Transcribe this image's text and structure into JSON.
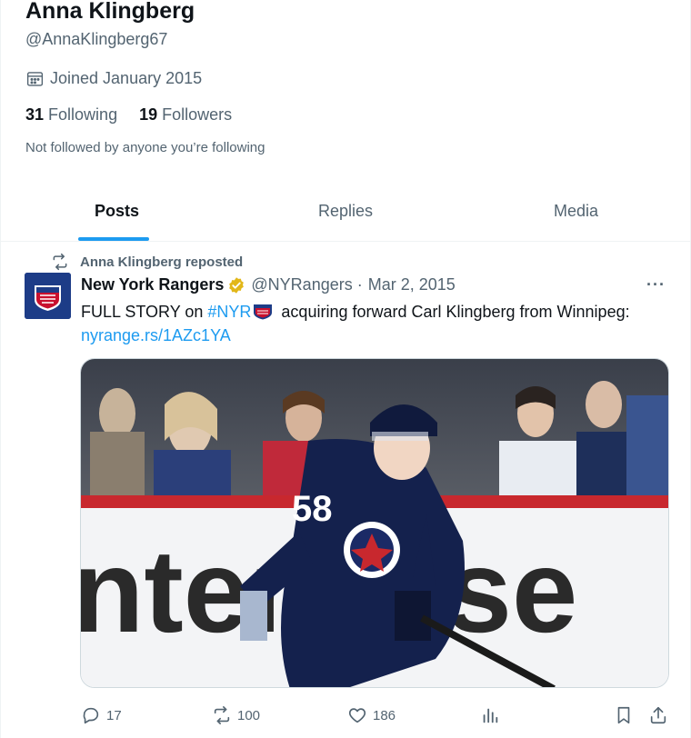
{
  "profile": {
    "name": "Anna Klingberg",
    "handle": "@AnnaKlingberg67",
    "joined": "Joined January 2015",
    "following_count": "31",
    "following_label": "Following",
    "followers_count": "19",
    "followers_label": "Followers",
    "not_followed": "Not followed by anyone you’re following"
  },
  "tabs": [
    {
      "label": "Posts",
      "active": true
    },
    {
      "label": "Replies",
      "active": false
    },
    {
      "label": "Media",
      "active": false
    }
  ],
  "post": {
    "repost_label": "Anna Klingberg reposted",
    "author": "New York Rangers",
    "handle": "@NYRangers",
    "separator": "·",
    "date": "Mar 2, 2015",
    "more": "···",
    "text_prefix": "FULL STORY on ",
    "hashtag": "#NYR",
    "text_suffix": " acquiring forward Carl Klingberg from Winnipeg:",
    "link": "nyrange.rs/1AZc1YA",
    "media_board_text": "nterprise",
    "jersey_number": "58",
    "stats": {
      "replies": "17",
      "reposts": "100",
      "likes": "186"
    }
  },
  "icons": {
    "joined": "calendar-icon",
    "repost": "repost-icon",
    "verified": "verified-badge-icon",
    "reply": "reply-icon",
    "like": "heart-icon",
    "views": "analytics-icon",
    "bookmark": "bookmark-icon",
    "share": "share-icon"
  },
  "colors": {
    "accent": "#1d9bf0",
    "text_primary": "#0f1419",
    "text_secondary": "#536471",
    "verified_gold": "#e2b719"
  }
}
